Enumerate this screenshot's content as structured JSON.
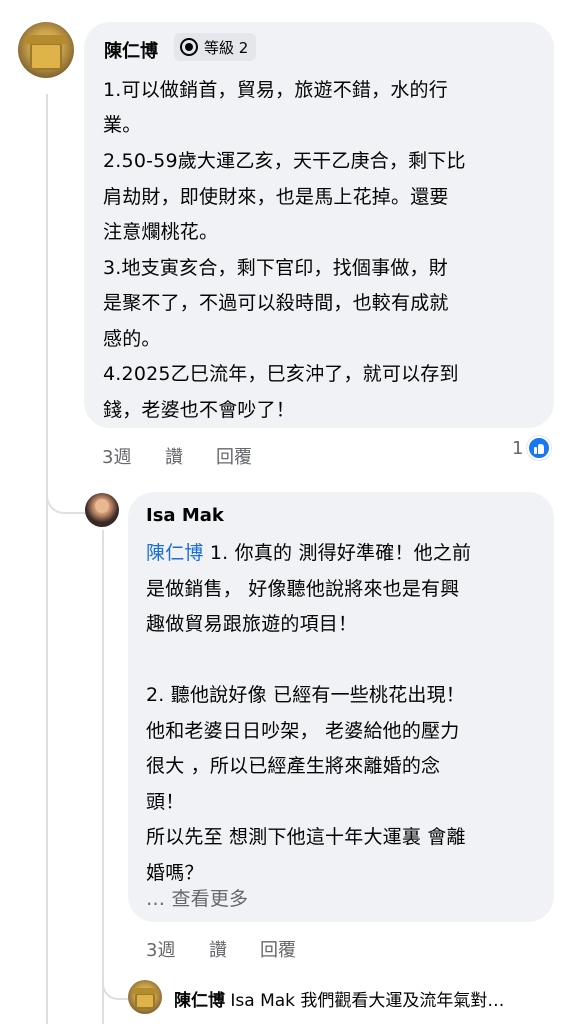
{
  "comment1": {
    "author": "陳仁博",
    "badge": "等級 2",
    "lines": [
      "1.可以做銷首，貿易，旅遊不錯，水的行",
      "業。",
      "2.50-59歲大運乙亥，天干乙庚合，剩下比",
      "肩劫財，即使財來，也是馬上花掉。還要",
      "注意爛桃花。",
      "3.地支寅亥合，剩下官印，找個事做，財",
      "是聚不了，不過可以殺時間，也較有成就",
      "感的。",
      "4.2025乙巳流年，巳亥沖了，就可以存到",
      "錢，老婆也不會吵了！"
    ],
    "time": "3週",
    "like_label": "讚",
    "reply_label": "回覆",
    "reaction_count": "1"
  },
  "comment2": {
    "author": "Isa Mak",
    "mention": "陳仁博",
    "first_line_rest": " 1. 你真的 測得好準確！他之前",
    "lines": [
      "是做銷售， 好像聽他說將來也是有興",
      "趣做貿易跟旅遊的項目！",
      "",
      "2. 聽他說好像 已經有一些桃花出現！",
      "他和老婆日日吵架， 老婆給他的壓力",
      "很大 ，所以已經產生將來離婚的念",
      "頭！",
      "所以先至 想測下他這十年大運裏 會離",
      "婚嗎？"
    ],
    "see_more": "… 查看更多",
    "time": "3週",
    "like_label": "讚",
    "reply_label": "回覆"
  },
  "reply_preview": {
    "author": "陳仁博",
    "text": "Isa Mak 我們觀看大運及流年氣對…"
  }
}
